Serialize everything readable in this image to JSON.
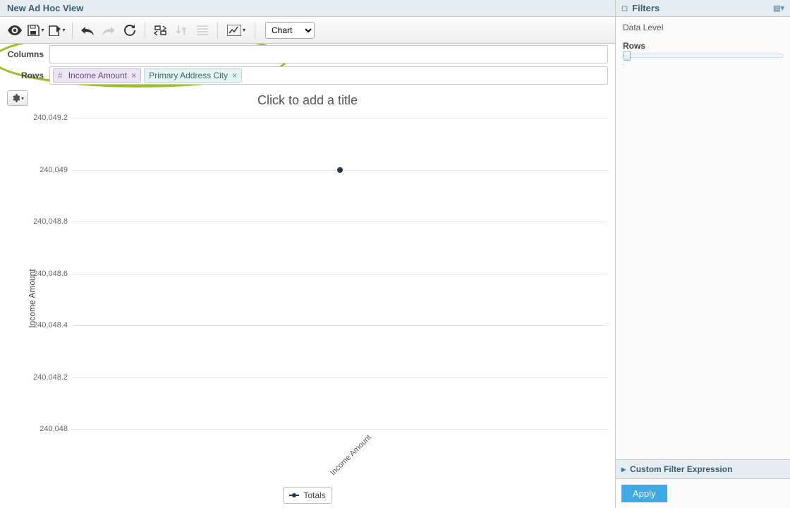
{
  "colors": {
    "accent": "#1e9adf",
    "callout": "#9abf2a"
  },
  "header": {
    "title": "New Ad Hoc View"
  },
  "toolbar": {
    "view_select": "Chart",
    "icons": {
      "eye": "preview",
      "save": "save",
      "export": "export",
      "undo": "undo",
      "redo": "redo",
      "reset": "reset",
      "pivot": "pivot",
      "sort": "sort",
      "detail": "detail",
      "chartfmt": "chart-format"
    }
  },
  "shelves": {
    "columns_label": "Columns",
    "rows_label": "Rows",
    "rows": [
      {
        "type": "measure",
        "label": "Income Amount"
      },
      {
        "type": "dimension",
        "label": "Primary Address City"
      }
    ]
  },
  "chart_data": {
    "type": "line",
    "title_placeholder": "Click to add a title",
    "ylabel": "Income Amount",
    "yticks": [
      "240,048",
      "240,048.2",
      "240,048.4",
      "240,048.6",
      "240,048.8",
      "240,049",
      "240,049.2"
    ],
    "ylim": [
      240048,
      240049.2
    ],
    "x_category": "Income Amount",
    "series": [
      {
        "name": "Totals",
        "values": [
          240049
        ]
      }
    ],
    "legend": "Totals"
  },
  "filters": {
    "title": "Filters",
    "data_level_label": "Data Level",
    "rows_label": "Rows",
    "slider_min_mark": ".",
    "cfe_label": "Custom Filter Expression",
    "apply_label": "Apply"
  }
}
